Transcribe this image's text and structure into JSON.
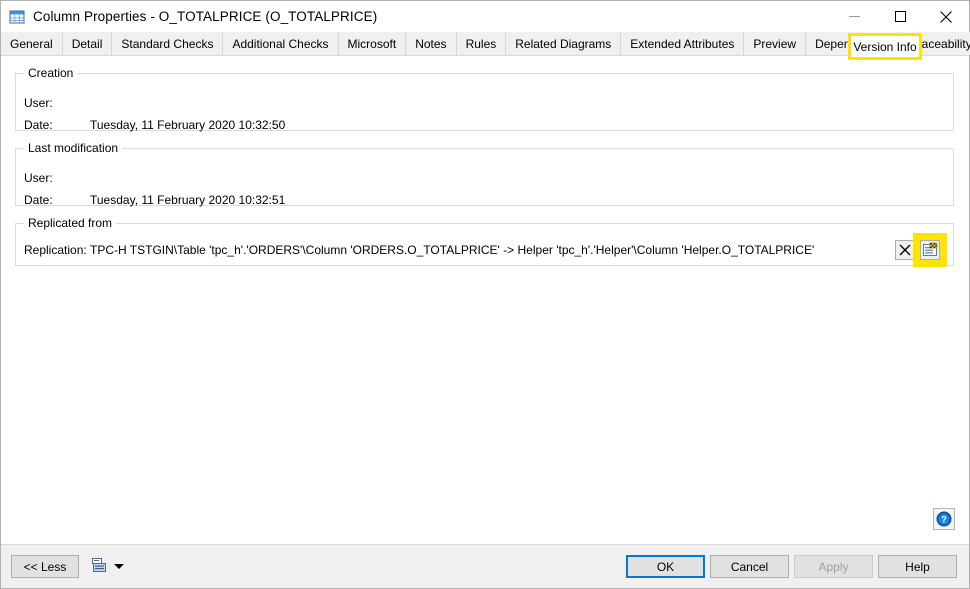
{
  "window": {
    "title": "Column Properties - O_TOTALPRICE (O_TOTALPRICE)",
    "icon": "table-grid-icon",
    "controls": {
      "minimize": "minimize-icon",
      "maximize": "maximize-icon",
      "close": "close-icon"
    }
  },
  "tabs": {
    "items": [
      {
        "label": "General"
      },
      {
        "label": "Detail"
      },
      {
        "label": "Standard Checks"
      },
      {
        "label": "Additional Checks"
      },
      {
        "label": "Microsoft"
      },
      {
        "label": "Notes"
      },
      {
        "label": "Rules"
      },
      {
        "label": "Related Diagrams"
      },
      {
        "label": "Extended Attributes"
      },
      {
        "label": "Preview"
      },
      {
        "label": "Dependencies"
      },
      {
        "label": "Traceability Links"
      }
    ],
    "active": {
      "label": "Version Info",
      "highlight_color": "#ffe400"
    }
  },
  "groups": {
    "creation": {
      "legend": "Creation",
      "user_label": "User:",
      "user_value": "",
      "date_label": "Date:",
      "date_value": "Tuesday, 11 February 2020 10:32:50"
    },
    "last_modification": {
      "legend": "Last modification",
      "user_label": "User:",
      "user_value": "",
      "date_label": "Date:",
      "date_value": "Tuesday, 11 February 2020 10:32:51"
    },
    "replicated_from": {
      "legend": "Replicated from",
      "replication_label": "Replication:",
      "replication_value": "TPC-H TSTGIN\\Table 'tpc_h'.'ORDERS'\\Column 'ORDERS.O_TOTALPRICE' -> Helper 'tpc_h'.'Helper'\\Column 'Helper.O_TOTALPRICE'",
      "delete_button_icon": "close-x-icon",
      "properties_button_icon": "replication-properties-icon",
      "properties_button_highlight_color": "#ffe400"
    }
  },
  "help_button": {
    "icon": "help-question-icon"
  },
  "footer": {
    "less_label": "<< Less",
    "print_icon": "report-print-icon",
    "print_dropdown_icon": "chevron-down-icon",
    "ok_label": "OK",
    "cancel_label": "Cancel",
    "apply_label": "Apply",
    "apply_disabled": true,
    "help_label": "Help"
  }
}
